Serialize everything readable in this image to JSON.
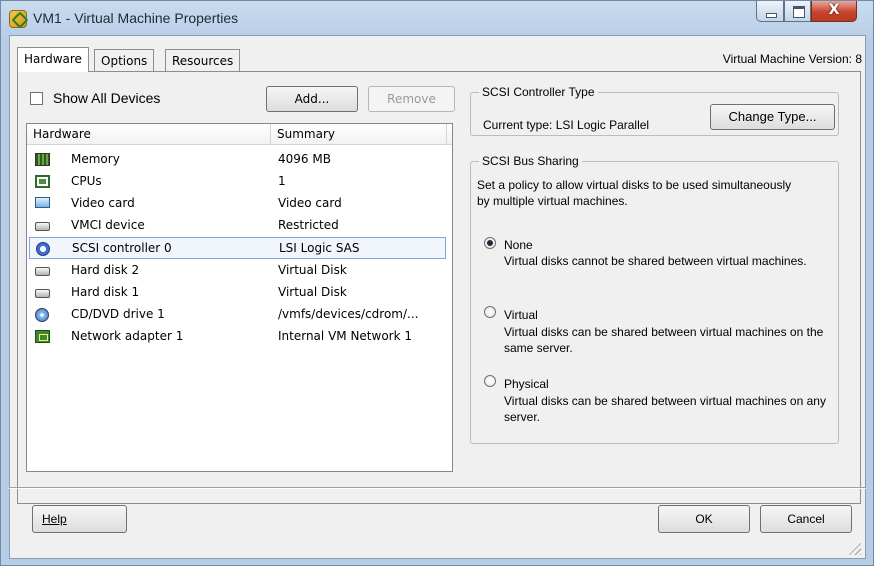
{
  "window": {
    "title": "VM1 - Virtual Machine Properties",
    "close_glyph": "X"
  },
  "tabs": [
    {
      "label": "Hardware",
      "active": true
    },
    {
      "label": "Options",
      "active": false
    },
    {
      "label": "Resources",
      "active": false
    }
  ],
  "vm_version": "Virtual Machine Version: 8",
  "show_all_devices": {
    "label": "Show All Devices",
    "checked": false
  },
  "buttons": {
    "add": "Add...",
    "remove": "Remove",
    "change_type": "Change Type...",
    "ok": "OK",
    "cancel": "Cancel",
    "help": "Help"
  },
  "device_list": {
    "columns": [
      "Hardware",
      "Summary"
    ],
    "rows": [
      {
        "icon": "memory-icon",
        "name": "Memory",
        "summary": "4096 MB"
      },
      {
        "icon": "cpu-icon",
        "name": "CPUs",
        "summary": "1"
      },
      {
        "icon": "monitor-icon",
        "name": "Video card",
        "summary": "Video card"
      },
      {
        "icon": "device-icon",
        "name": "VMCI device",
        "summary": "Restricted"
      },
      {
        "icon": "scsi-icon",
        "name": "SCSI controller 0",
        "summary": "LSI Logic SAS",
        "selected": true
      },
      {
        "icon": "disk-icon",
        "name": "Hard disk 2",
        "summary": "Virtual Disk"
      },
      {
        "icon": "disk-icon",
        "name": "Hard disk 1",
        "summary": "Virtual Disk"
      },
      {
        "icon": "cd-icon",
        "name": "CD/DVD drive 1",
        "summary": "/vmfs/devices/cdrom/..."
      },
      {
        "icon": "network-icon",
        "name": "Network adapter 1",
        "summary": "Internal VM Network 1"
      }
    ]
  },
  "scsi_controller_type": {
    "legend": "SCSI Controller Type",
    "current_type": "Current type:  LSI Logic Parallel"
  },
  "scsi_bus_sharing": {
    "legend": "SCSI Bus Sharing",
    "description": "Set a policy to allow virtual disks to be used simultaneously by multiple virtual machines.",
    "options": [
      {
        "label": "None",
        "desc": "Virtual disks cannot be shared between virtual machines.",
        "selected": true
      },
      {
        "label": "Virtual",
        "desc": "Virtual disks can be shared between virtual machines on the same server.",
        "selected": false
      },
      {
        "label": "Physical",
        "desc": "Virtual disks can be shared between virtual machines on any server.",
        "selected": false
      }
    ]
  }
}
